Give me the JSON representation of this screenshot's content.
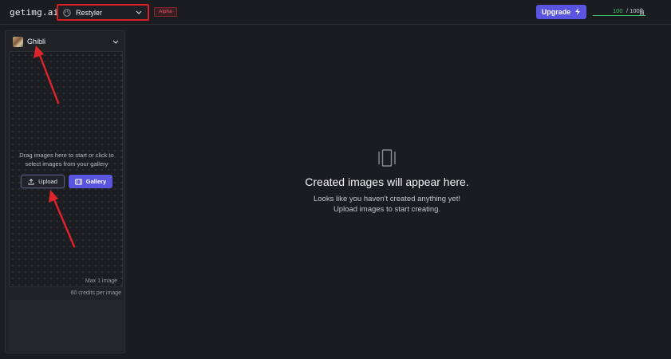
{
  "app": {
    "logo": "getimg.ai"
  },
  "toolbar": {
    "tool_select": {
      "label": "Restyler",
      "icon": "palette-icon"
    },
    "alpha_badge": "Alpha",
    "upgrade_label": "Upgrade",
    "credits": {
      "current": "100",
      "max": "/ 100"
    }
  },
  "sidebar": {
    "style_select": {
      "label": "Ghibli"
    },
    "dropzone": {
      "text": "Drag images here to start or click to select images from your gallery",
      "upload_label": "Upload",
      "gallery_label": "Gallery",
      "max_note": "Max 1 image"
    },
    "credit_note": "60 credits per image"
  },
  "main": {
    "empty_title": "Created images will appear here.",
    "empty_line1": "Looks like you haven't created anything yet!",
    "empty_line2": "Upload images to start creating."
  },
  "colors": {
    "accent": "#5a55e0",
    "highlight": "#d61f26",
    "credits_green": "#3fc26b"
  }
}
